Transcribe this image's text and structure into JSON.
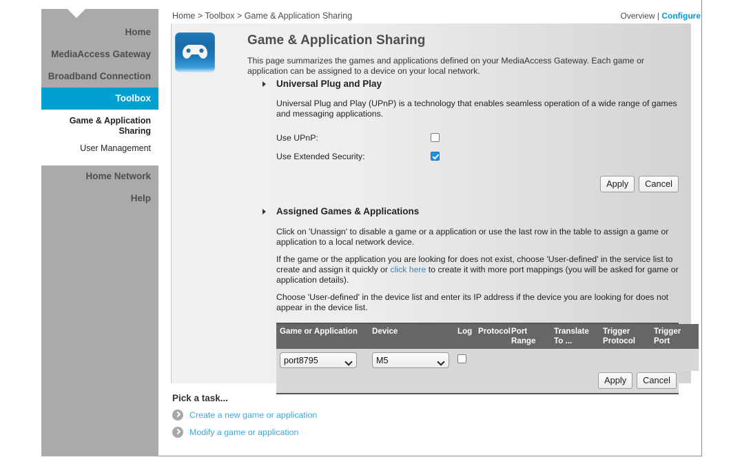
{
  "breadcrumb": "Home > Toolbox > Game & Application Sharing",
  "topright": {
    "overview_label": "Overview",
    "separator": " | ",
    "configure_label": "Configure"
  },
  "sidebar": {
    "items": [
      {
        "label": "Home",
        "active": false
      },
      {
        "label": "MediaAccess Gateway",
        "active": false
      },
      {
        "label": "Broadband Connection",
        "active": false
      },
      {
        "label": "Toolbox",
        "active": true
      }
    ],
    "subitems": [
      {
        "label": "Game & Application Sharing",
        "selected": true
      },
      {
        "label": "User Management",
        "selected": false
      }
    ],
    "items_after": [
      {
        "label": "Home Network",
        "active": false
      },
      {
        "label": "Help",
        "active": false
      }
    ]
  },
  "page": {
    "icon": "gamepad-icon",
    "title": "Game & Application Sharing",
    "description": "This page summarizes the games and applications defined on your MediaAccess Gateway. Each game or application can be assigned to a device on your local network."
  },
  "upnp": {
    "heading": "Universal Plug and Play",
    "paragraph": "Universal Plug and Play (UPnP) is a technology that enables seamless operation of a wide range of games and messaging applications.",
    "use_upnp_label": "Use UPnP:",
    "use_upnp_checked": false,
    "extended_security_label": "Use Extended Security:",
    "extended_security_checked": true,
    "apply_label": "Apply",
    "cancel_label": "Cancel"
  },
  "assigned": {
    "heading": "Assigned Games & Applications",
    "paragraph1": "Click on 'Unassign' to disable a game or a application or use the last row in the table to assign a game or application to a local network device.",
    "paragraph2_before": "If the game or the application you are looking for does not exist, choose 'User-defined' in the service list to create and assign it quickly or ",
    "paragraph2_link": "click here",
    "paragraph2_after": " to create it with more port mappings (you will be asked for game or application details).",
    "paragraph3": "Choose 'User-defined' in the device list and enter its IP address if the device you are looking for does not appear in the device list.",
    "columns": [
      "Game or Application",
      "Device",
      "Log",
      "Protocol",
      "Port Range",
      "Translate To ...",
      "Trigger Protocol",
      "Trigger Port"
    ],
    "row": {
      "game_value": "port8795",
      "device_value": "M5",
      "log_checked": false,
      "protocol": "",
      "port_range": "",
      "translate_to": "",
      "trigger_protocol": "",
      "trigger_port": ""
    },
    "apply_label": "Apply",
    "cancel_label": "Cancel"
  },
  "tasks": {
    "title": "Pick a task...",
    "items": [
      {
        "label": "Create a new game or application"
      },
      {
        "label": "Modify a game or application"
      }
    ]
  },
  "colors": {
    "accent": "#00a0d2",
    "link": "#3aa8dd",
    "sidebar_bg": "#aaaaaa",
    "table_header_bg": "#666666",
    "checkbox_checked": "#1e90e0"
  }
}
